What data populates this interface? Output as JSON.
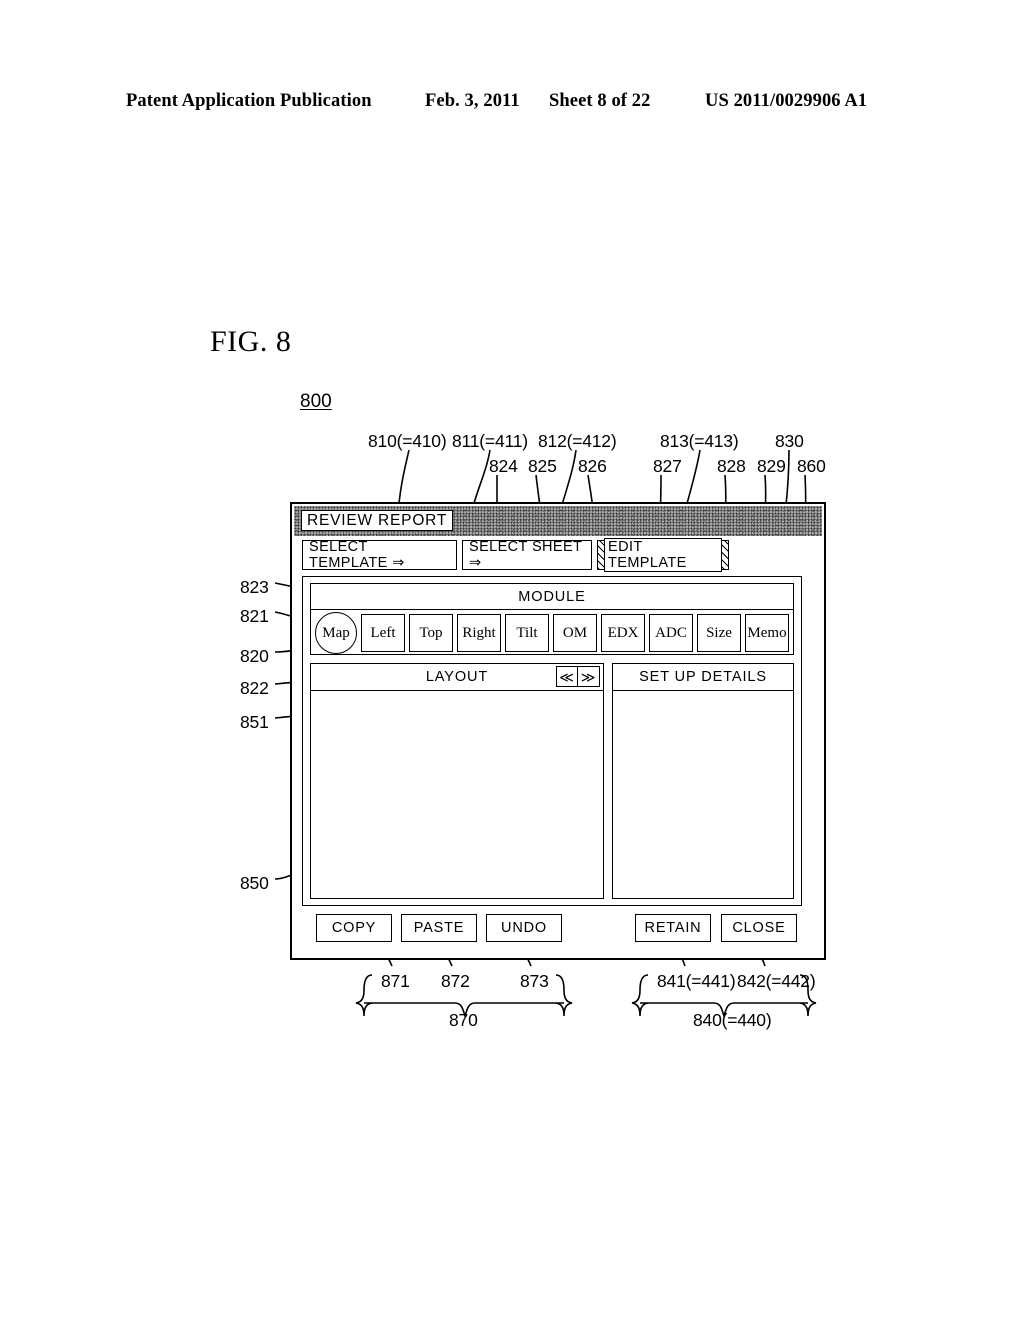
{
  "page_header": {
    "publication": "Patent Application Publication",
    "date": "Feb. 3, 2011",
    "sheet": "Sheet 8 of 22",
    "patent_number": "US 2011/0029906 A1"
  },
  "figure": {
    "label": "FIG. 8",
    "figure_ref": "800"
  },
  "dialog": {
    "title": "REVIEW REPORT",
    "tabs": [
      {
        "label": "SELECT TEMPLATE ⇒",
        "selected": false
      },
      {
        "label": "SELECT SHEET ⇒",
        "selected": false
      },
      {
        "label": "EDIT TEMPLATE",
        "selected": true
      }
    ],
    "module": {
      "header": "MODULE",
      "buttons": [
        {
          "label": "Map",
          "shape": "circle"
        },
        {
          "label": "Left",
          "shape": "rect"
        },
        {
          "label": "Top",
          "shape": "rect"
        },
        {
          "label": "Right",
          "shape": "rect"
        },
        {
          "label": "Tilt",
          "shape": "rect"
        },
        {
          "label": "OM",
          "shape": "rect"
        },
        {
          "label": "EDX",
          "shape": "rect"
        },
        {
          "label": "ADC",
          "shape": "rect"
        },
        {
          "label": "Size",
          "shape": "rect"
        },
        {
          "label": "Memo",
          "shape": "rect"
        }
      ]
    },
    "layout_panel": {
      "header": "LAYOUT",
      "nav_prev": "≪",
      "nav_next": "≫"
    },
    "details_panel": {
      "header": "SET UP DETAILS"
    },
    "actions": {
      "copy": "COPY",
      "paste": "PASTE",
      "undo": "UNDO",
      "retain": "RETAIN",
      "close": "CLOSE"
    }
  },
  "reference_numbers": {
    "top_row_1": [
      {
        "id": "r810",
        "text": "810(=410)"
      },
      {
        "id": "r811",
        "text": "811(=411)"
      },
      {
        "id": "r812",
        "text": "812(=412)"
      },
      {
        "id": "r813",
        "text": "813(=413)"
      },
      {
        "id": "r830",
        "text": "830"
      }
    ],
    "top_row_2": [
      {
        "id": "r824",
        "text": "824"
      },
      {
        "id": "r825",
        "text": "825"
      },
      {
        "id": "r826",
        "text": "826"
      },
      {
        "id": "r827",
        "text": "827"
      },
      {
        "id": "r828",
        "text": "828"
      },
      {
        "id": "r829",
        "text": "829"
      },
      {
        "id": "r860",
        "text": "860"
      }
    ],
    "left_column": [
      {
        "id": "r823",
        "text": "823"
      },
      {
        "id": "r821",
        "text": "821"
      },
      {
        "id": "r820",
        "text": "820"
      },
      {
        "id": "r822",
        "text": "822"
      },
      {
        "id": "r851",
        "text": "851"
      },
      {
        "id": "r850",
        "text": "850"
      }
    ],
    "bottom_row": [
      {
        "id": "r871",
        "text": "871"
      },
      {
        "id": "r872",
        "text": "872"
      },
      {
        "id": "r873",
        "text": "873"
      },
      {
        "id": "r841",
        "text": "841(=441)"
      },
      {
        "id": "r842",
        "text": "842(=442)"
      }
    ],
    "bottom_group": [
      {
        "id": "r870",
        "text": "870"
      },
      {
        "id": "r840",
        "text": "840(=440)"
      }
    ]
  }
}
